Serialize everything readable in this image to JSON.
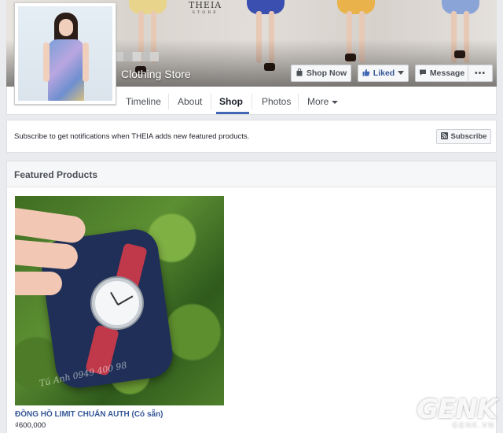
{
  "page": {
    "store_title": "Clothing Store",
    "cover_brand": "THEIA",
    "cover_brand_sub": "STORE"
  },
  "actions": {
    "shop_now": "Shop Now",
    "liked": "Liked",
    "message": "Message",
    "more": "•••"
  },
  "nav": {
    "items": [
      "Timeline",
      "About",
      "Shop",
      "Photos",
      "More"
    ],
    "active": "Shop"
  },
  "subscribe": {
    "text": "Subscribe to get notifications when THEIA adds new featured products.",
    "button": "Subscribe"
  },
  "featured": {
    "title": "Featured Products",
    "product": {
      "name": "ĐỒNG HỒ LIMIT CHUẨN AUTH (Có sẵn)",
      "price": "₫600,000",
      "image_watermark": "Tú Anh 0949 400 98"
    }
  },
  "watermark": {
    "brand": "GENK",
    "sub": "GENK.VN"
  }
}
